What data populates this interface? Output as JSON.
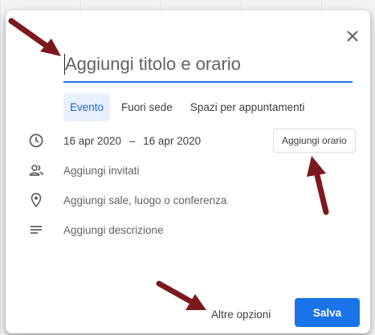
{
  "dialog": {
    "title_placeholder": "Aggiungi titolo e orario",
    "tabs": [
      {
        "label": "Evento",
        "active": true
      },
      {
        "label": "Fuori sede",
        "active": false
      },
      {
        "label": "Spazi per appuntamenti",
        "active": false
      }
    ],
    "date_start": "16 apr 2020",
    "date_separator": "–",
    "date_end": "16 apr 2020",
    "add_time_label": "Aggiungi orario",
    "add_guests_label": "Aggiungi invitati",
    "add_location_label": "Aggiungi sale, luogo o conferenza",
    "add_description_label": "Aggiungi descrizione",
    "more_options_label": "Altre opzioni",
    "save_label": "Salva"
  },
  "colors": {
    "accent": "#1a73e8",
    "annotation_arrow": "#7b1a1e"
  },
  "icons": [
    "close-icon",
    "clock-icon",
    "people-icon",
    "location-pin-icon",
    "description-icon"
  ]
}
